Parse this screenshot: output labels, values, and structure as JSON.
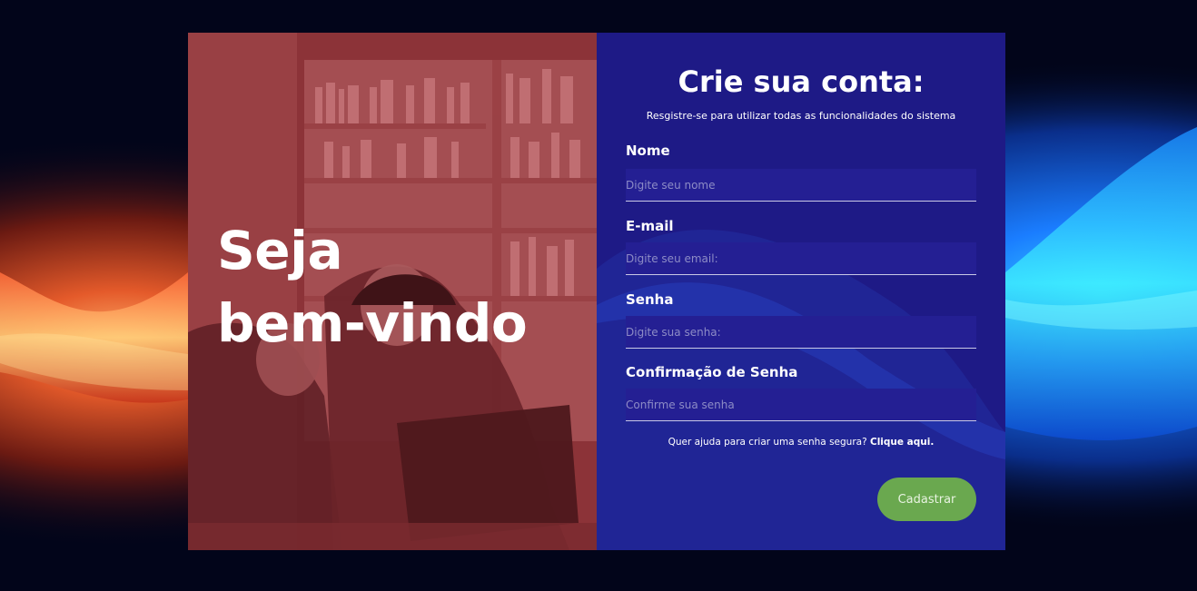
{
  "welcome": {
    "line1": "Seja",
    "line2": "bem-vindo"
  },
  "form": {
    "title": "Crie sua conta:",
    "subtitle": "Resgistre-se para utilizar todas as funcionalidades do sistema",
    "fields": [
      {
        "label": "Nome",
        "placeholder": "Digite seu nome",
        "value": ""
      },
      {
        "label": "E-mail",
        "placeholder": "Digite seu email:",
        "value": ""
      },
      {
        "label": "Senha",
        "placeholder": "Digite sua senha:",
        "value": ""
      },
      {
        "label": "Confirmação de Senha",
        "placeholder": "Confirme sua senha",
        "value": ""
      }
    ],
    "help_text": "Quer ajuda para criar uma senha segura?",
    "help_link": "Clique aqui.",
    "submit_label": "Cadastrar"
  },
  "colors": {
    "left_overlay": "#8a2f34",
    "form_panel": "#1e1a86",
    "submit_button": "#6aa84f",
    "page_background": "#02051a"
  }
}
